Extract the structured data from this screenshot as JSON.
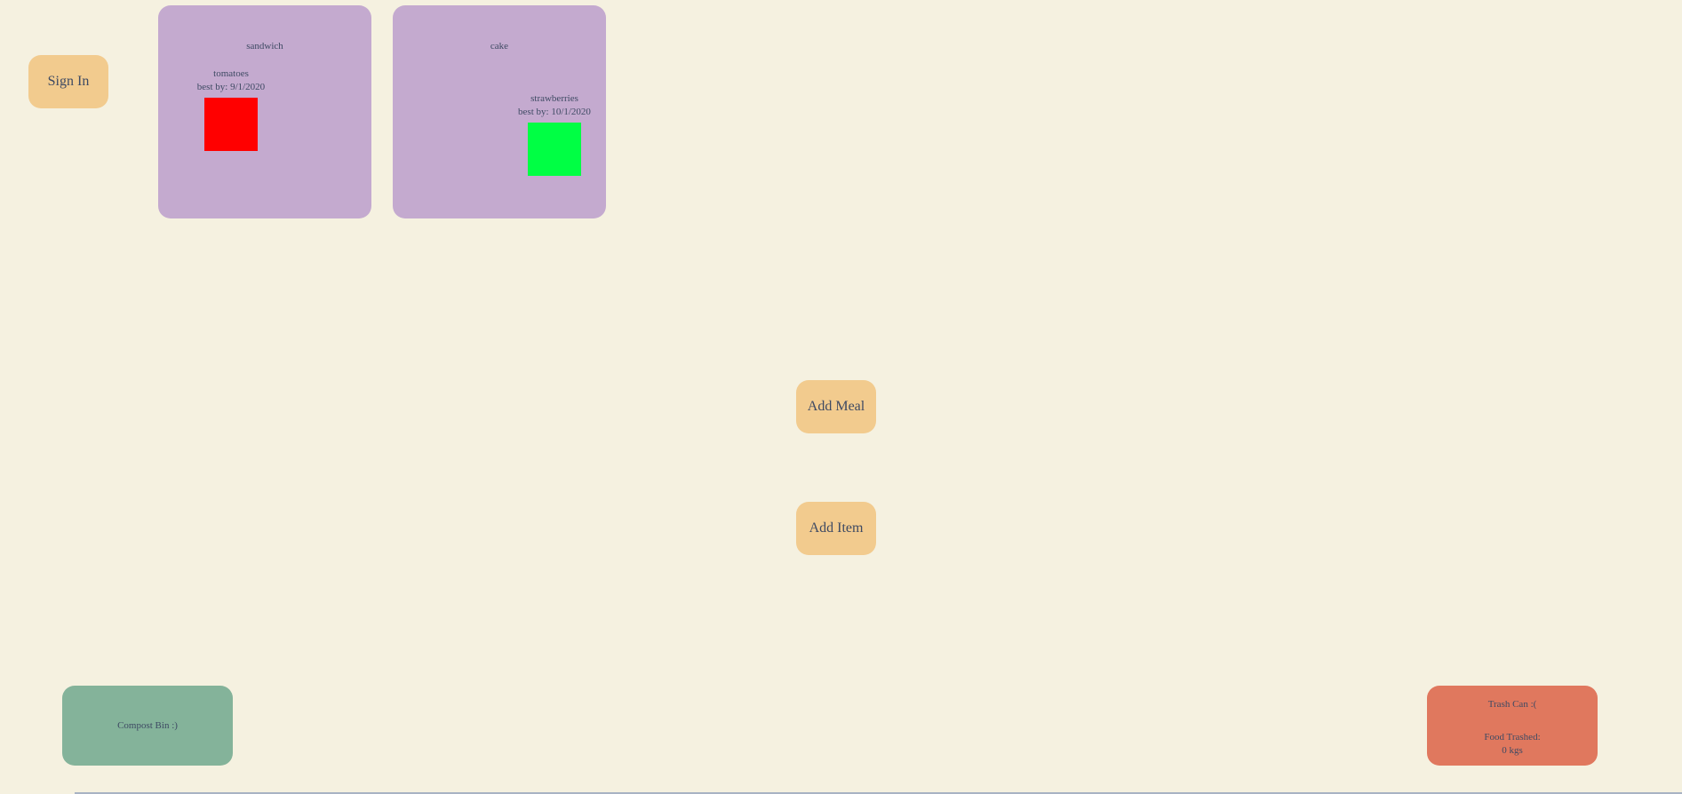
{
  "auth": {
    "sign_in_label": "Sign In"
  },
  "meals": [
    {
      "title": "sandwich",
      "items": [
        {
          "name": "tomatoes",
          "best_by": "best by: 9/1/2020",
          "color": "#ff0000"
        }
      ]
    },
    {
      "title": "cake",
      "items": [
        {
          "name": "strawberries",
          "best_by": "best by: 10/1/2020",
          "color": "#00ff44"
        }
      ]
    }
  ],
  "actions": {
    "add_meal_label": "Add Meal",
    "add_item_label": "Add Item"
  },
  "compost": {
    "label": "Compost Bin :)",
    "color": "#84b39a"
  },
  "trash": {
    "label": "Trash Can :(",
    "trashed_label": "Food Trashed:",
    "trashed_amount": "0 kgs",
    "color": "#e0785e"
  },
  "theme": {
    "background": "#f5f1e0",
    "button": "#f2cb8e",
    "card": "#c4aacf",
    "text": "#3e4a63"
  }
}
